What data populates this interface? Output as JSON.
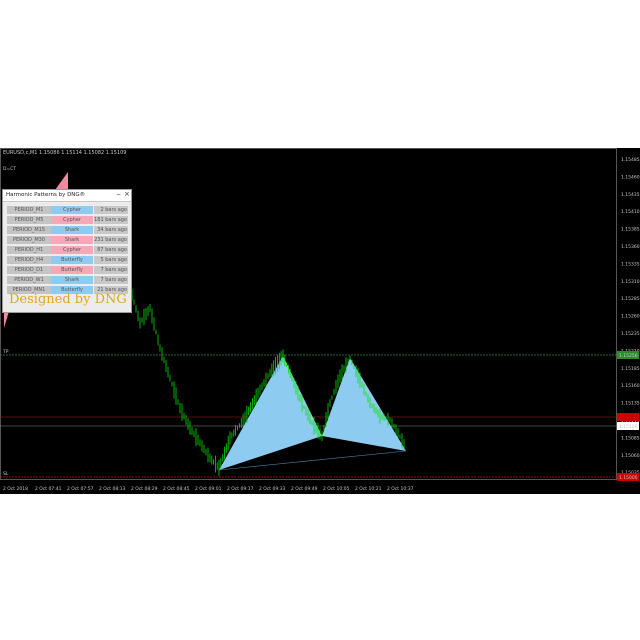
{
  "chart": {
    "symbol_line": "EURUSD,c,M1 1.15086 1.15114 1.15082 1.15109",
    "price_labels": [
      "1.15485",
      "1.15460",
      "1.15435",
      "1.15410",
      "1.15385",
      "1.15360",
      "1.15335",
      "1.15310",
      "1.15285",
      "1.15260",
      "1.15235",
      "1.15210",
      "1.15185",
      "1.15160",
      "1.15135",
      "1.15110",
      "1.15085",
      "1.15060",
      "1.15035"
    ],
    "time_labels": [
      "2 Oct 2018",
      "2 Oct 07:41",
      "2 Oct 07:57",
      "2 Oct 08:13",
      "2 Oct 08:29",
      "2 Oct 08:45",
      "2 Oct 09:01",
      "2 Oct 09:17",
      "2 Oct 09:33",
      "2 Oct 09:49",
      "2 Oct 10:05",
      "2 Oct 10:21",
      "2 Oct 10:37"
    ],
    "tp_label": "TP",
    "sl_label": "SL",
    "tp_price_tag": "1.15256",
    "current_price_tag": "1.15109",
    "sl_price_tag": "1.15000",
    "top_left_label": "D=CT",
    "colors": {
      "background": "#000000",
      "candles": "#00ff00",
      "pattern_fill": "#8ecbf0",
      "tp_line": "#2e8b2e",
      "sl_line": "#cc0000",
      "current_price": "#ffffff",
      "designed_by": "#e0a81a"
    }
  },
  "panel": {
    "title": "Harmonic Patterns by DNG®",
    "minimize_icon": "minimize-icon",
    "close_icon": "close-icon",
    "rows": [
      {
        "period": "PERIOD_M1",
        "pattern": "Cypher",
        "bars": "2 bars ago",
        "color": "blue"
      },
      {
        "period": "PERIOD_M5",
        "pattern": "Cypher",
        "bars": "181 bars ago",
        "color": "pink"
      },
      {
        "period": "PERIOD_M15",
        "pattern": "Shark",
        "bars": "34 bars ago",
        "color": "blue"
      },
      {
        "period": "PERIOD_M30",
        "pattern": "Shark",
        "bars": "231 bars ago",
        "color": "pink"
      },
      {
        "period": "PERIOD_H1",
        "pattern": "Cypher",
        "bars": "87 bars ago",
        "color": "pink"
      },
      {
        "period": "PERIOD_H4",
        "pattern": "Butterfly",
        "bars": "5 bars ago",
        "color": "blue"
      },
      {
        "period": "PERIOD_D1",
        "pattern": "Butterfly",
        "bars": "7 bars ago",
        "color": "pink"
      },
      {
        "period": "PERIOD_W1",
        "pattern": "Shark",
        "bars": "7 bars ago",
        "color": "blue"
      },
      {
        "period": "PERIOD_MN1",
        "pattern": "Butterfly",
        "bars": "21 bars ago",
        "color": "blue"
      }
    ],
    "designed_by": "Designed by DNG"
  }
}
